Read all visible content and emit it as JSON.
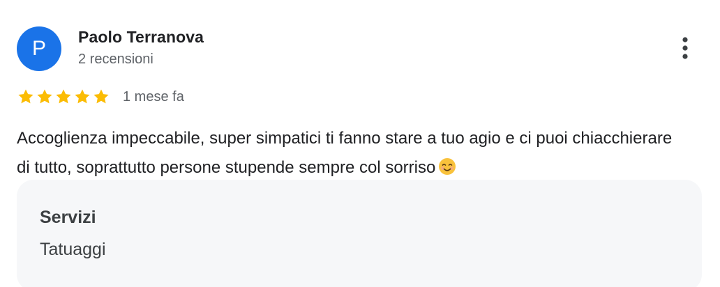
{
  "review": {
    "avatar_letter": "P",
    "author_name": "Paolo Terranova",
    "author_meta": "2 recensioni",
    "rating": 5,
    "rating_max": 5,
    "date": "1 mese fa",
    "text": "Accoglienza impeccabile, super simpatici ti fanno stare a tuo agio e ci puoi chiacchierare di tutto, soprattutto persone stupende sempre col sorriso"
  },
  "service": {
    "heading": "Servizi",
    "value": "Tatuaggi"
  },
  "icons": {
    "menu": "more-vert-icon",
    "star": "star-icon",
    "emoji": "smiling-face-emoji"
  },
  "colors": {
    "avatar_bg": "#1a73e8",
    "star": "#fbbc04",
    "service_bg": "#f6f7f9"
  }
}
